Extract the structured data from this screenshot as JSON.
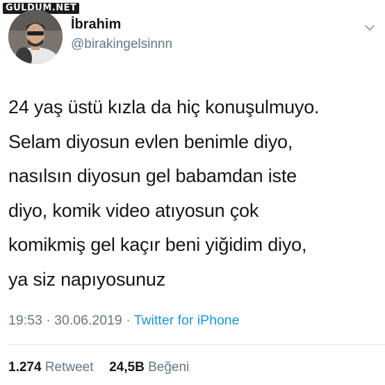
{
  "watermark": "GULDUM.NET",
  "author": {
    "name": "İbrahim",
    "handle": "@birakingelsinnn"
  },
  "tweet": {
    "lines": [
      "24 yaş üstü kızla da hiç konuşulmuyo.",
      "Selam diyosun evlen benimle diyo,",
      "nasılsın diyosun gel babamdan iste",
      "diyo, komik video atıyosun çok",
      "komikmiş gel kaçır beni yiğidim diyo,",
      "ya siz napıyosunuz"
    ]
  },
  "meta": {
    "time": "19:53",
    "separator": "·",
    "date": "30.06.2019",
    "source": "Twitter for iPhone"
  },
  "stats": {
    "retweet_count": "1.274",
    "retweet_label": "Retweet",
    "like_count": "24,5B",
    "like_label": "Beğeni"
  },
  "icons": {
    "menu": "chevron-down-icon"
  },
  "colors": {
    "text": "#14171a",
    "secondary": "#657786",
    "link": "#1b95e0",
    "divider": "#e1e8ed"
  }
}
